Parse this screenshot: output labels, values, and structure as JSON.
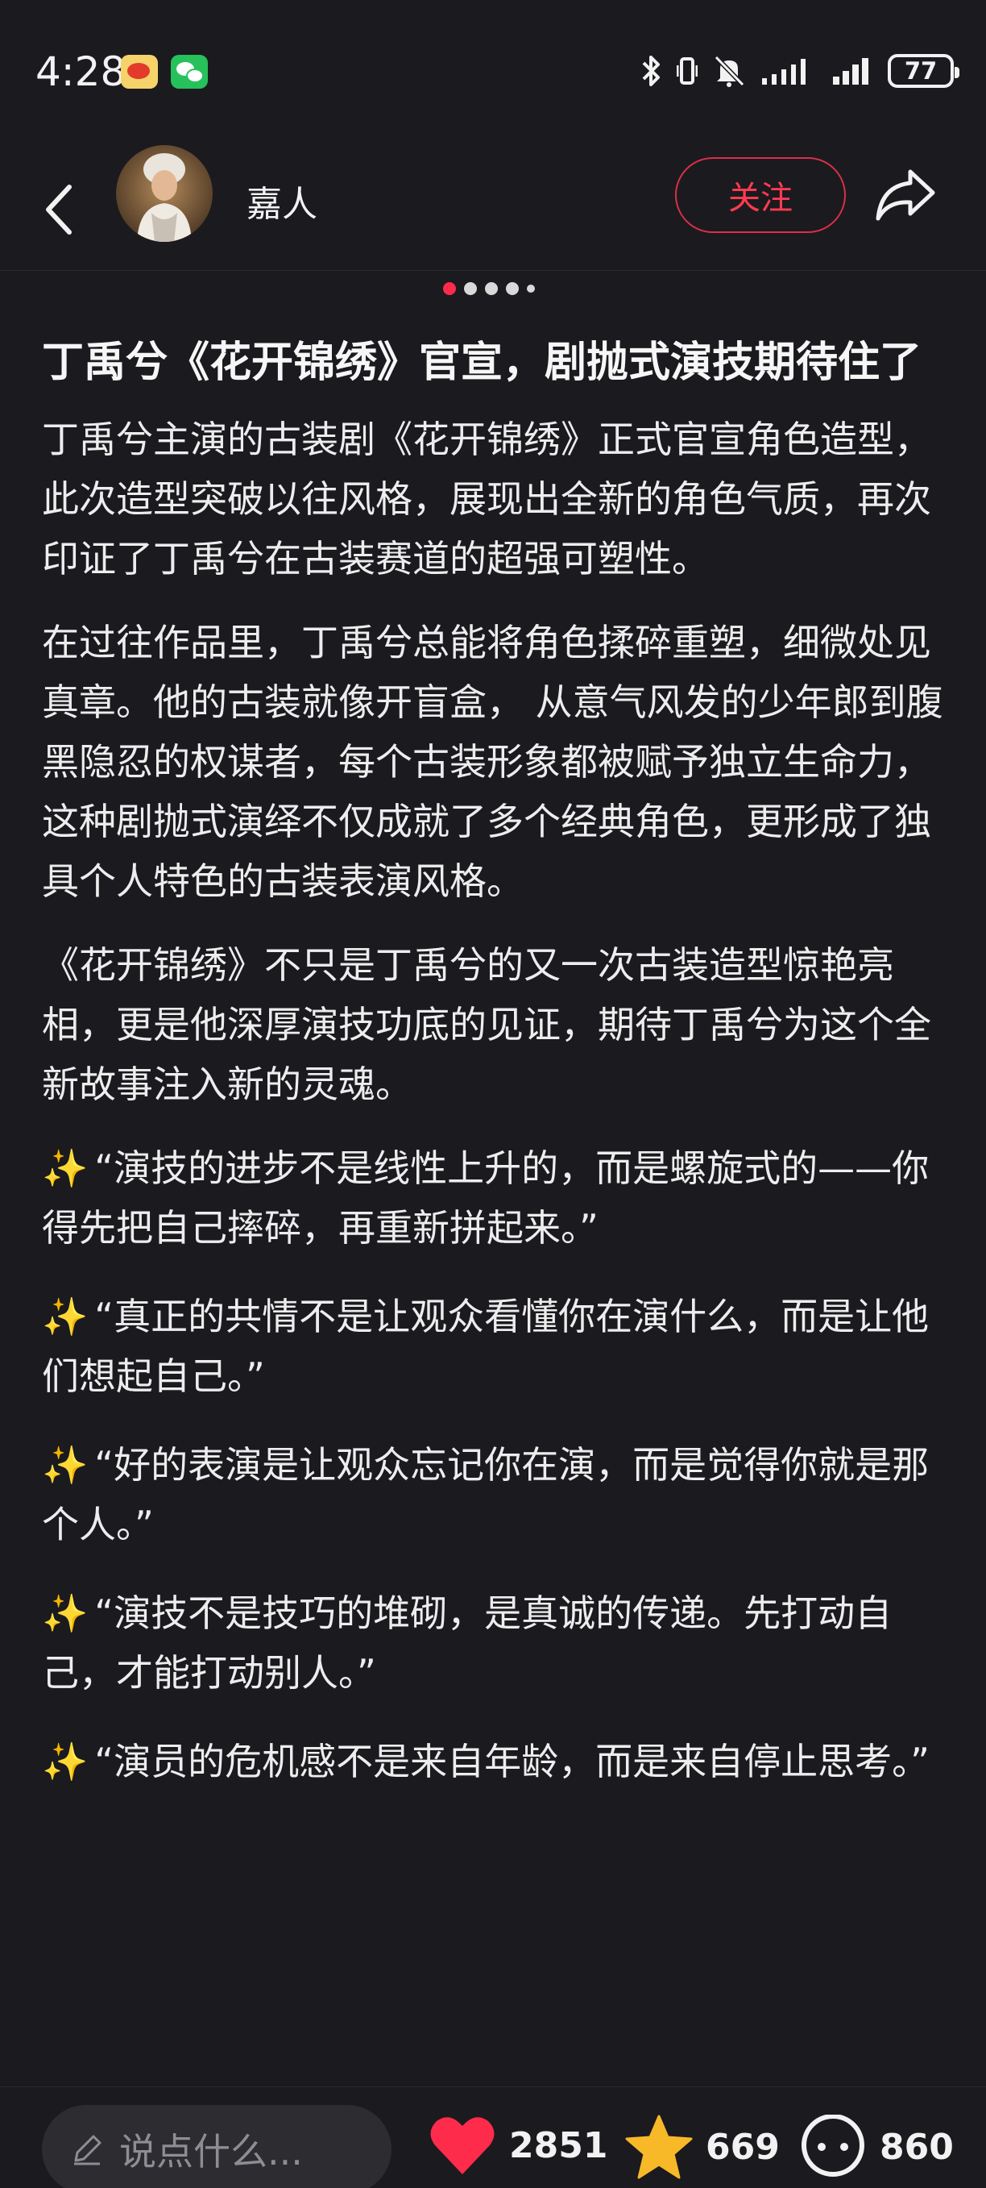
{
  "status_bar": {
    "time": "4:28",
    "battery": "77"
  },
  "header": {
    "username": "嘉人",
    "follow_label": "关注"
  },
  "pager": {
    "total": 5,
    "active": 1
  },
  "post": {
    "title": "丁禹兮《花开锦绣》官宣，剧抛式演技期待住了",
    "paragraphs": [
      "丁禹兮主演的古装剧《花开锦绣》正式官宣角色造型，此次造型突破以往风格，展现出全新的角色气质，再次印证了丁禹兮在古装赛道的超强可塑性。",
      "在过往作品里，丁禹兮总能将角色揉碎重塑，细微处见真章。他的古装就像开盲盒， 从意气风发的少年郎到腹黑隐忍的权谋者，每个古装形象都被赋予独立生命力，这种剧抛式演绎不仅成就了多个经典角色，更形成了独具个人特色的古装表演风格。",
      "《花开锦绣》不只是丁禹兮的又一次古装造型惊艳亮相，更是他深厚演技功底的见证，期待丁禹兮为这个全新故事注入新的灵魂。"
    ],
    "quotes": [
      "“演技的进步不是线性上升的，而是螺旋式的——你得先把自己摔碎，再重新拼起来。”",
      "“真正的共情不是让观众看懂你在演什么，而是让他们想起自己。”",
      "“好的表演是让观众忘记你在演，而是觉得你就是那个人。”",
      "“演技不是技巧的堆砌，是真诚的传递。先打动自己，才能打动别人。”",
      "“演员的危机感不是来自年龄，而是来自停止思考。”"
    ],
    "quote_prefix": "✨"
  },
  "bottom_bar": {
    "comment_placeholder": "说点什么...",
    "like_count": "2851",
    "star_count": "669",
    "comment_count": "860"
  },
  "colors": {
    "background": "#1b1a1f",
    "accent": "#ff2b4b",
    "star": "#f7b928"
  }
}
